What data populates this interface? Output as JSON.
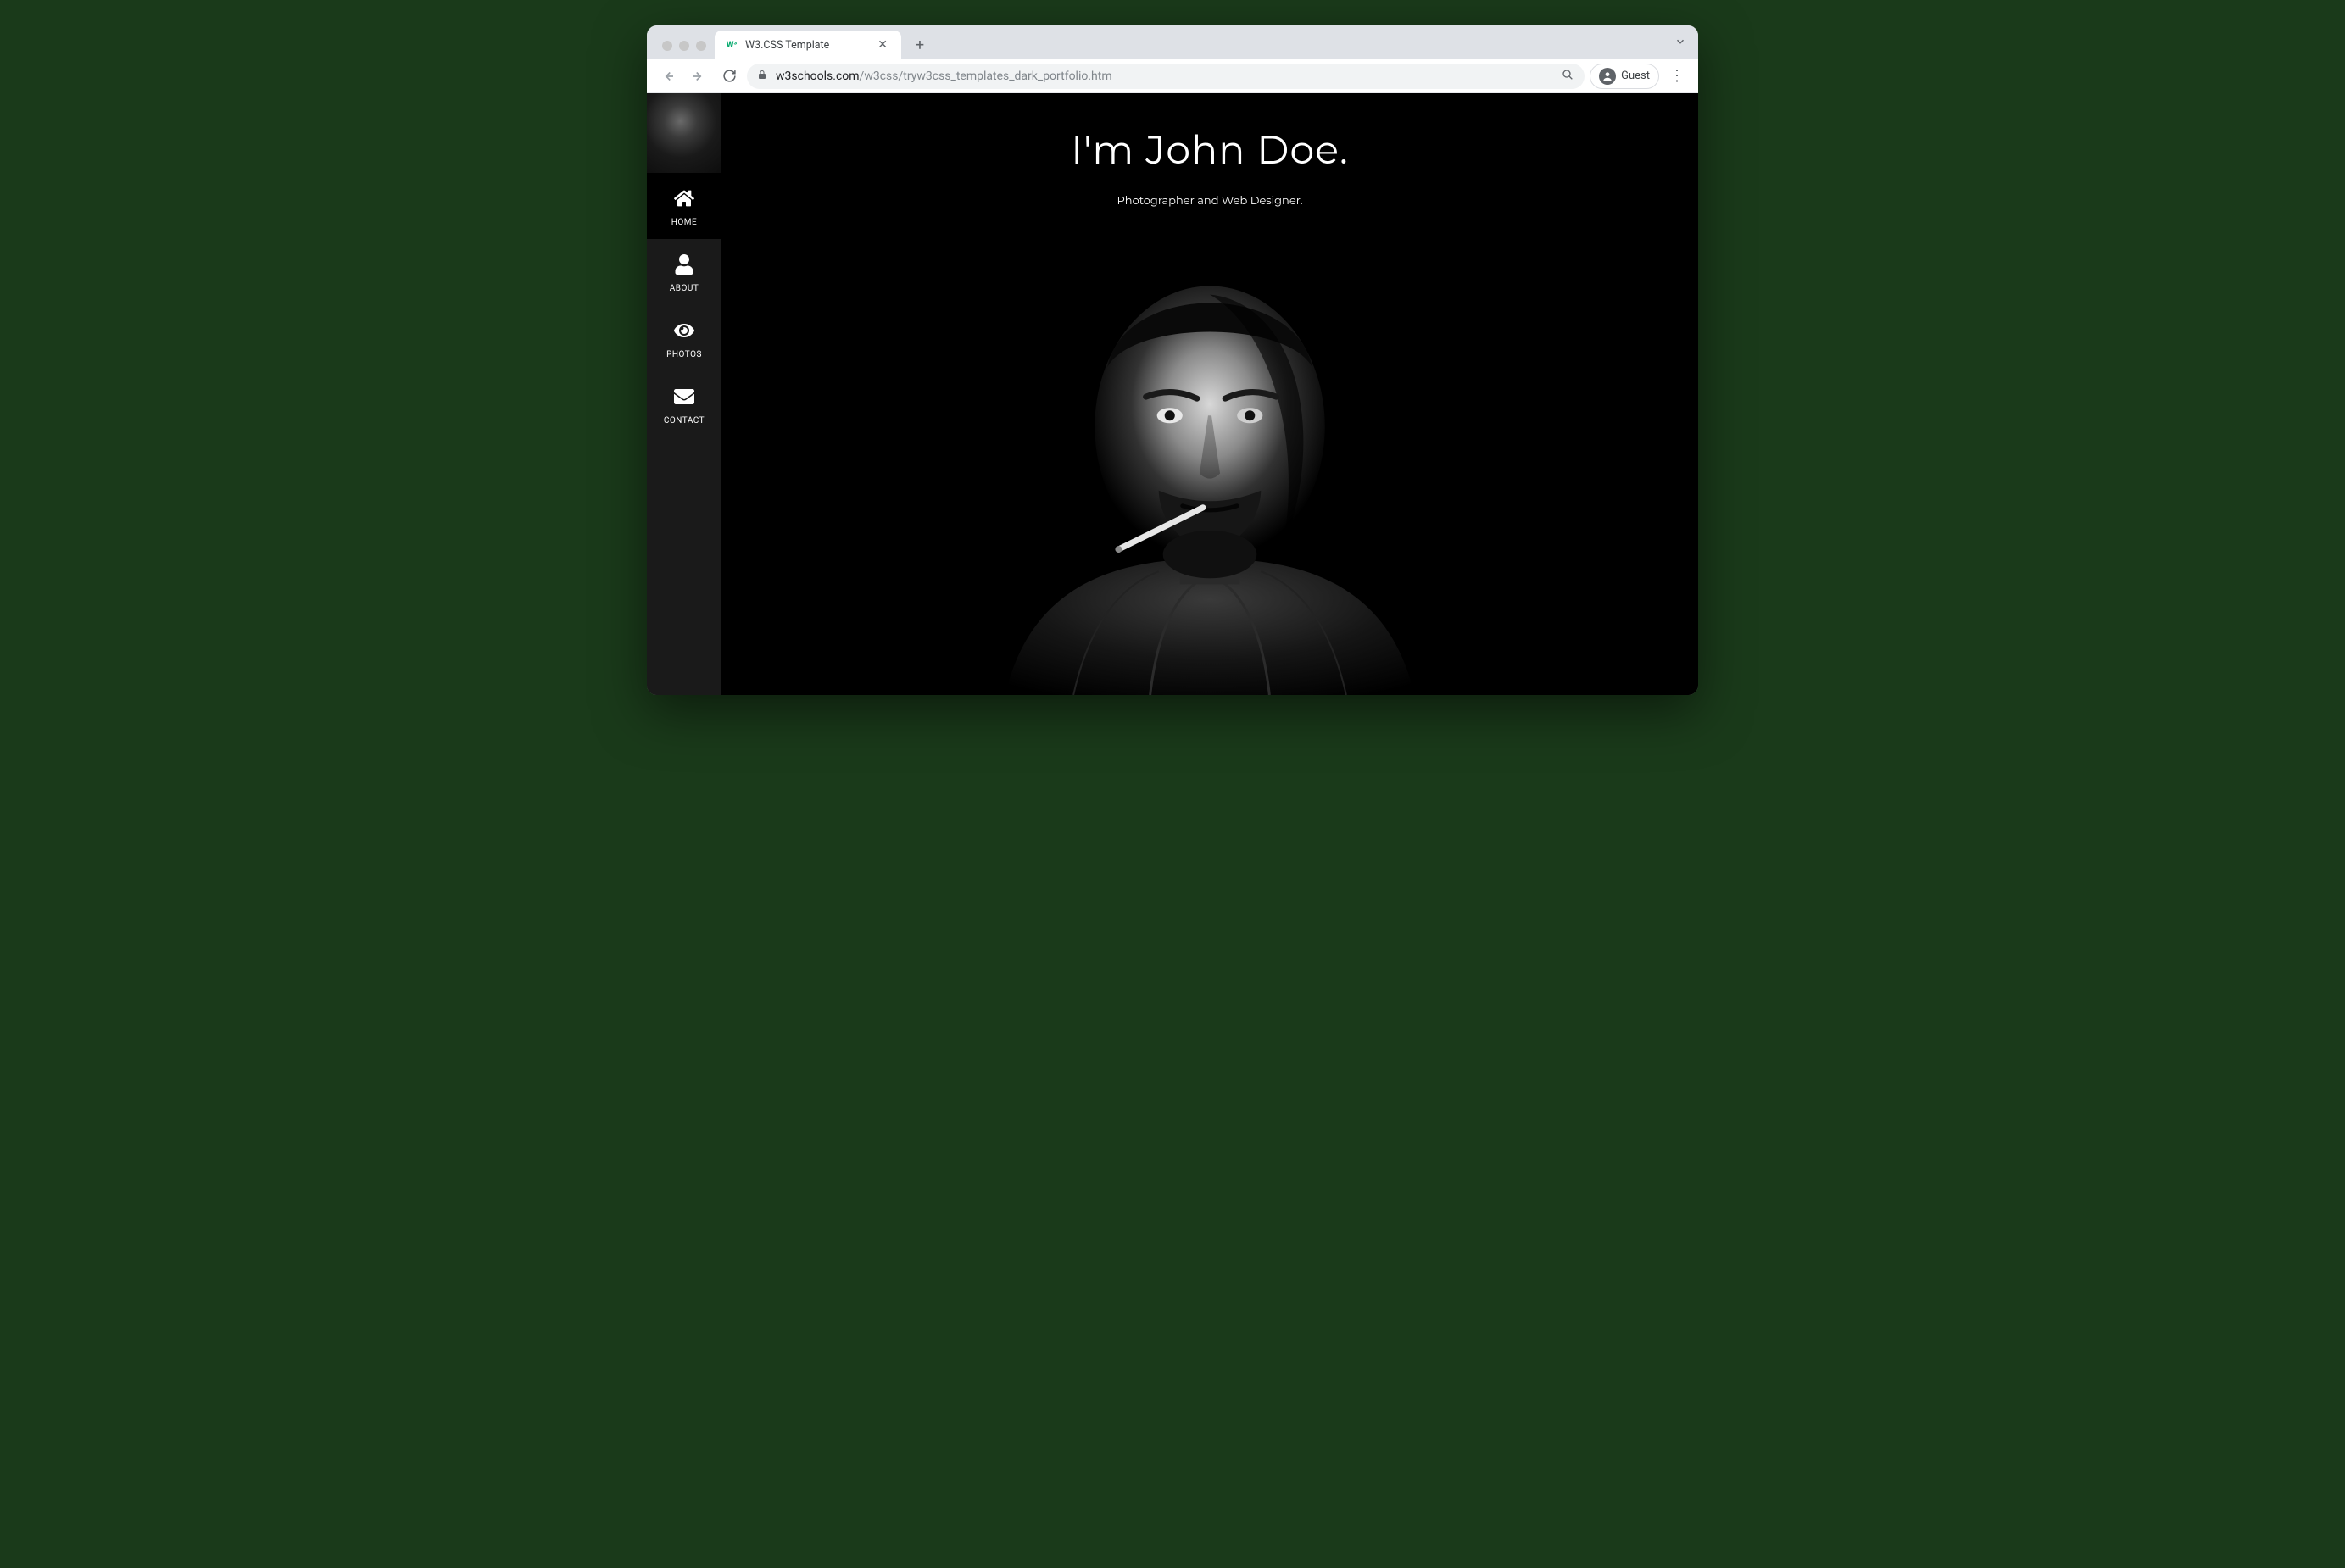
{
  "browser": {
    "tab_title": "W3.CSS Template",
    "url_host": "w3schools.com",
    "url_path": "/w3css/tryw3css_templates_dark_portfolio.htm",
    "profile_label": "Guest"
  },
  "sidebar": {
    "items": [
      {
        "label": "HOME",
        "icon": "home-icon",
        "active": true
      },
      {
        "label": "ABOUT",
        "icon": "user-icon",
        "active": false
      },
      {
        "label": "PHOTOS",
        "icon": "eye-icon",
        "active": false
      },
      {
        "label": "CONTACT",
        "icon": "envelope-icon",
        "active": false
      }
    ]
  },
  "hero": {
    "title": "I'm John Doe.",
    "subtitle": "Photographer and Web Designer."
  }
}
